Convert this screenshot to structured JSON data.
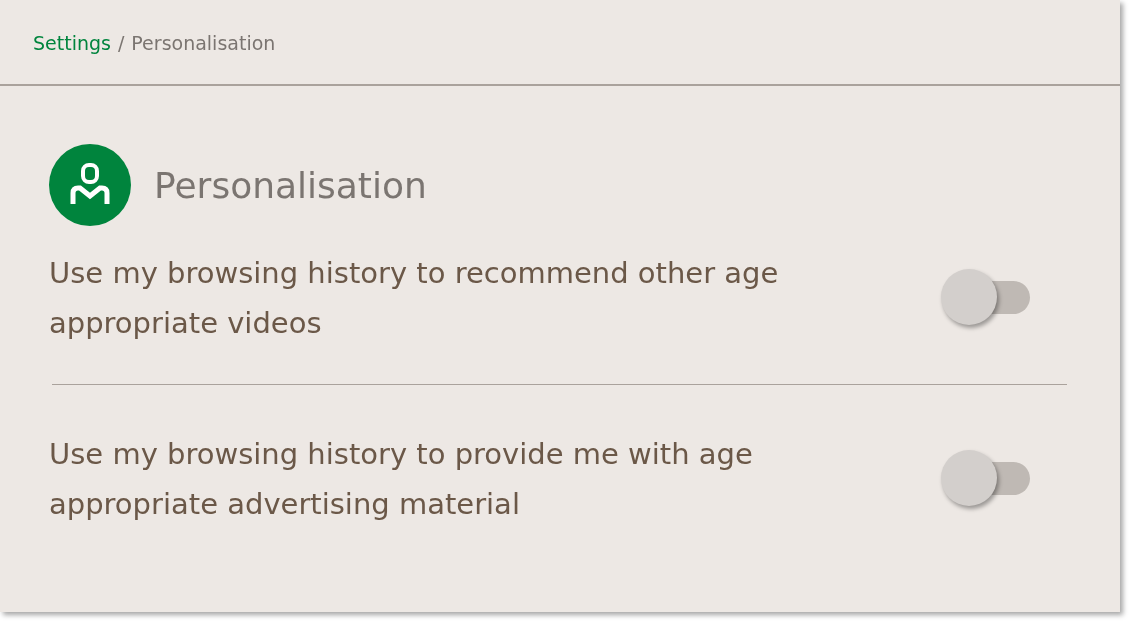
{
  "breadcrumb": {
    "parent": "Settings",
    "separator": "/",
    "current": "Personalisation"
  },
  "section": {
    "title": "Personalisation"
  },
  "settings": [
    {
      "label": "Use my browsing history to recommend other age appropriate videos",
      "on": false
    },
    {
      "label": "Use my browsing history to provide me with age appropriate advertising material",
      "on": false
    }
  ]
}
